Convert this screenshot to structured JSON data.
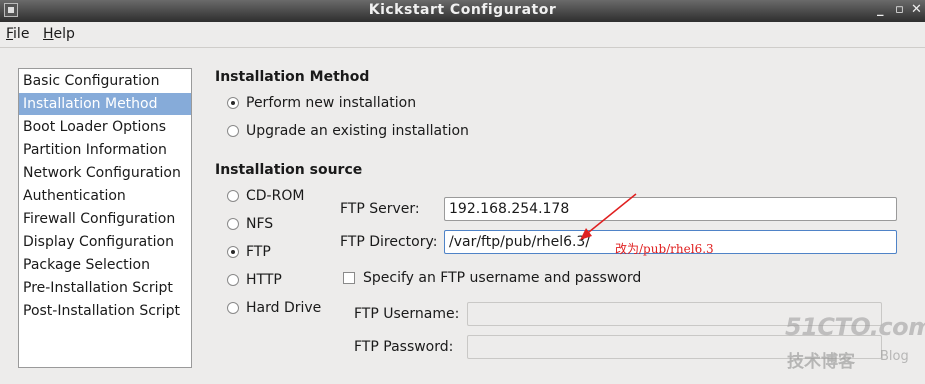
{
  "window": {
    "title": "Kickstart Configurator",
    "minimize_label": "_",
    "maximize_label": "▫",
    "close_label": "✕"
  },
  "menubar": {
    "file": "File",
    "help": "Help"
  },
  "sidebar": {
    "items": [
      {
        "label": "Basic Configuration"
      },
      {
        "label": "Installation Method"
      },
      {
        "label": "Boot Loader Options"
      },
      {
        "label": "Partition Information"
      },
      {
        "label": "Network Configuration"
      },
      {
        "label": "Authentication"
      },
      {
        "label": "Firewall Configuration"
      },
      {
        "label": "Display Configuration"
      },
      {
        "label": "Package Selection"
      },
      {
        "label": "Pre-Installation Script"
      },
      {
        "label": "Post-Installation Script"
      }
    ],
    "selected": "Installation Method"
  },
  "installation_method": {
    "title": "Installation Method",
    "options": [
      {
        "label": "Perform new installation",
        "selected": true
      },
      {
        "label": "Upgrade an existing installation",
        "selected": false
      }
    ]
  },
  "installation_source": {
    "title": "Installation source",
    "options": [
      {
        "label": "CD-ROM",
        "selected": false
      },
      {
        "label": "NFS",
        "selected": false
      },
      {
        "label": "FTP",
        "selected": true
      },
      {
        "label": "HTTP",
        "selected": false
      },
      {
        "label": "Hard Drive",
        "selected": false
      }
    ]
  },
  "ftp": {
    "server_label": "FTP Server:",
    "server_value": "192.168.254.178",
    "directory_label": "FTP Directory:",
    "directory_value": "/var/ftp/pub/rhel6.3/",
    "auth_checkbox_label": "Specify an FTP username and password",
    "auth_checked": false,
    "username_label": "FTP Username:",
    "username_value": "",
    "password_label": "FTP Password:",
    "password_value": ""
  },
  "annotation": {
    "text": "改为/pub/rhel6.3",
    "color": "#e02020"
  },
  "watermark": {
    "brand": "51CTO.com",
    "subtitle": "技术博客",
    "blog": "Blog"
  },
  "colors": {
    "selection": "#86abd9",
    "titlebar": "#3a3a3a",
    "background": "#edeceb"
  }
}
